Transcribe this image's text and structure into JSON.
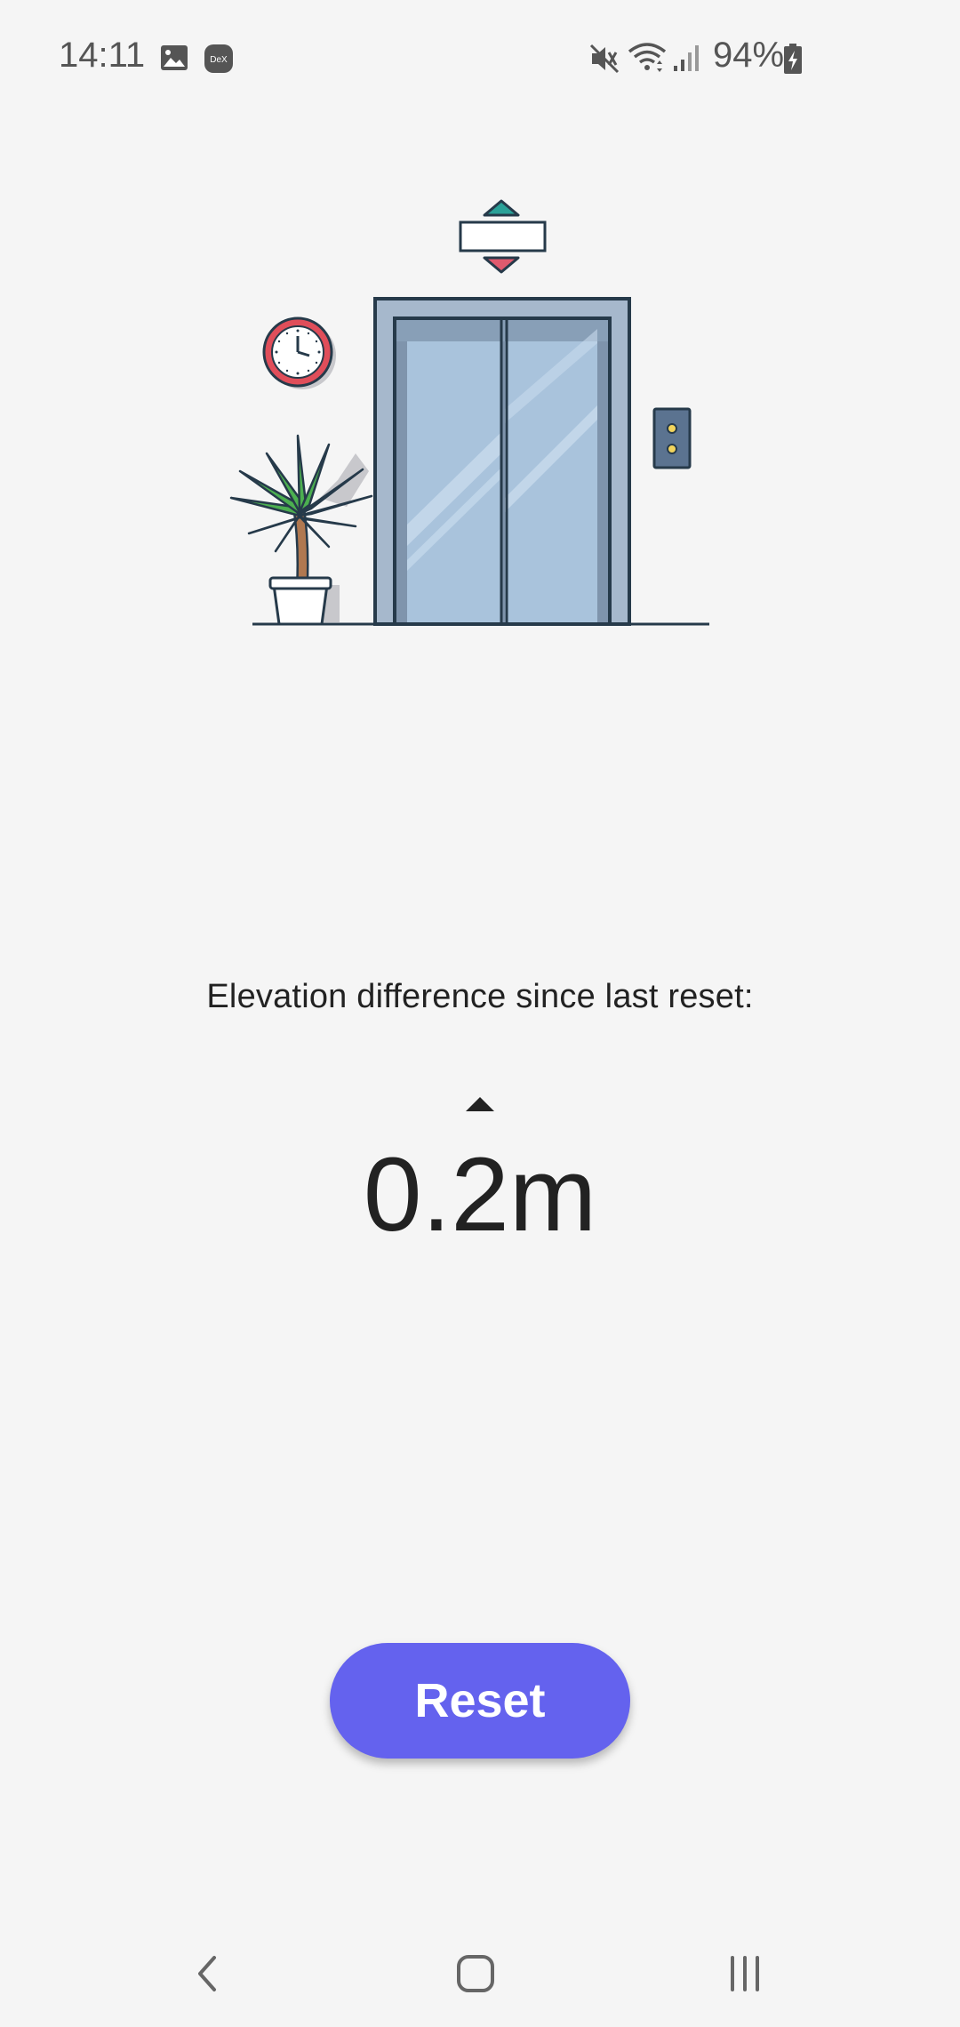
{
  "status_bar": {
    "time": "14:11",
    "battery_percent": "94%",
    "icons": [
      "gallery-icon",
      "dex-icon",
      "mute-icon",
      "wifi-icon",
      "signal-icon",
      "battery-charging-icon"
    ],
    "dex_label": "DeX"
  },
  "main": {
    "caption": "Elevation difference since last reset:",
    "direction": "up",
    "value": "0.2m"
  },
  "actions": {
    "reset_label": "Reset"
  },
  "nav_bar": {
    "icons": [
      "back-icon",
      "home-icon",
      "recents-icon"
    ]
  },
  "colors": {
    "accent": "#6462ee",
    "background": "#f5f5f5",
    "text": "#222222"
  }
}
